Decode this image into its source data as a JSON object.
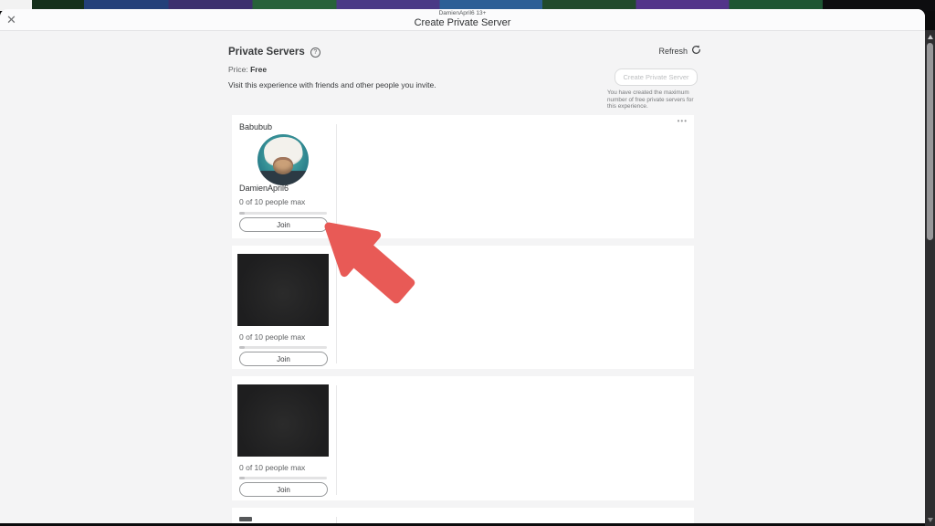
{
  "window": {
    "subtitle": "DamienApril6 13+",
    "title": "Create Private Server",
    "close_glyph": "✕"
  },
  "section": {
    "heading": "Private Servers",
    "help_icon": "?",
    "price_label": "Price:",
    "price_value": "Free",
    "description": "Visit this experience with friends and other people you invite.",
    "refresh_label": "Refresh",
    "create_button_label": "Create Private Server",
    "create_button_note": "You have created the maximum number of free private servers for this experience."
  },
  "servers": [
    {
      "name": "Babubub",
      "owner": "DamienApril6",
      "capacity": "0 of 10 people max",
      "join_label": "Join",
      "menu_icon": "•••"
    },
    {
      "capacity": "0 of 10 people max",
      "join_label": "Join"
    },
    {
      "capacity": "0 of 10 people max",
      "join_label": "Join"
    }
  ],
  "colors": {
    "annotation_arrow_red": "#e85a56",
    "redacted_thumbnail": "#1f1f20",
    "avatar_background_teal": "#2b818c"
  }
}
